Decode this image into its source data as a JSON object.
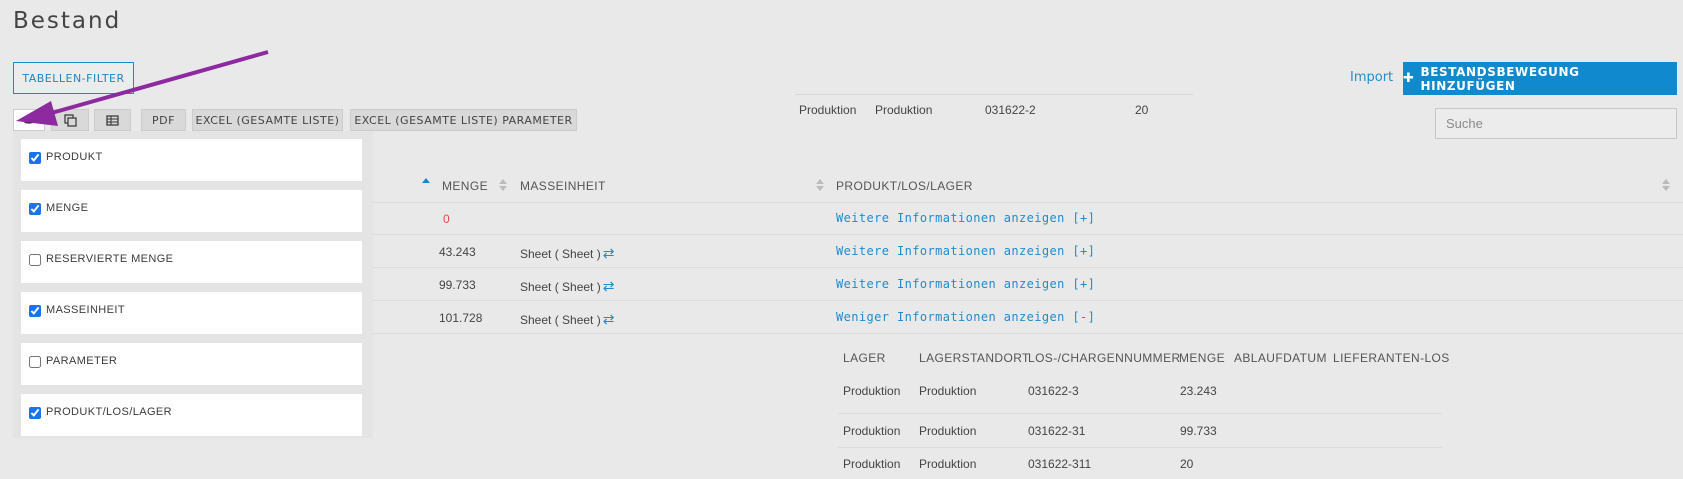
{
  "page": {
    "title": "Bestand"
  },
  "toolbar": {
    "filter_label": "TABELLEN-FILTER",
    "buttons": [
      "PDF",
      "EXCEL (GESAMTE LISTE)",
      "EXCEL (GESAMTE LISTE) PARAMETER"
    ],
    "icons": [
      "eye-icon",
      "copy-icon",
      "table-icon"
    ],
    "import_label": "Import",
    "add_label": "BESTANDSBEWEGUNG HINZUFÜGEN",
    "add_icon": "plus-icon"
  },
  "search": {
    "placeholder": "Suche",
    "value": ""
  },
  "top_row": {
    "lager": "Produktion",
    "standort": "Produktion",
    "los": "031622-2",
    "menge": "20"
  },
  "table": {
    "headers": {
      "menge": "MENGE",
      "masseinheit": "MASSEINHEIT",
      "produkt_los_lager": "PRODUKT/LOS/LAGER"
    },
    "rows": [
      {
        "menge": "0",
        "masseinheit": "",
        "link": "Weitere Informationen anzeigen [+]"
      },
      {
        "menge": "43.243",
        "masseinheit": "Sheet ( Sheet )",
        "link": "Weitere Informationen anzeigen [+]"
      },
      {
        "menge": "99.733",
        "masseinheit": "Sheet ( Sheet )",
        "link": "Weitere Informationen anzeigen [+]"
      },
      {
        "menge": "101.728",
        "masseinheit": "Sheet ( Sheet )",
        "link": "Weniger Informationen anzeigen [-]"
      }
    ]
  },
  "subtable": {
    "headers": [
      "LAGER",
      "LAGERSTANDORT",
      "LOS-/CHARGENNUMMER",
      "MENGE",
      "ABLAUFDATUM",
      "LIEFERANTEN-LOS"
    ],
    "rows": [
      [
        "Produktion",
        "Produktion",
        "031622-3",
        "23.243"
      ],
      [
        "Produktion",
        "Produktion",
        "031622-31",
        "99.733"
      ],
      [
        "Produktion",
        "Produktion",
        "031622-311",
        "20"
      ]
    ]
  },
  "column_menu": {
    "items": [
      {
        "label": "PRODUKT",
        "checked": true
      },
      {
        "label": "MENGE",
        "checked": true
      },
      {
        "label": "RESERVIERTE MENGE",
        "checked": false
      },
      {
        "label": "MASSEINHEIT",
        "checked": true
      },
      {
        "label": "PARAMETER",
        "checked": false
      },
      {
        "label": "PRODUKT/LOS/LAGER",
        "checked": true
      }
    ]
  },
  "colors": {
    "accent": "#1089cf",
    "link": "#1f8ccd",
    "annotation_arrow": "#8e2aa0",
    "zero_value": "#e04848"
  }
}
